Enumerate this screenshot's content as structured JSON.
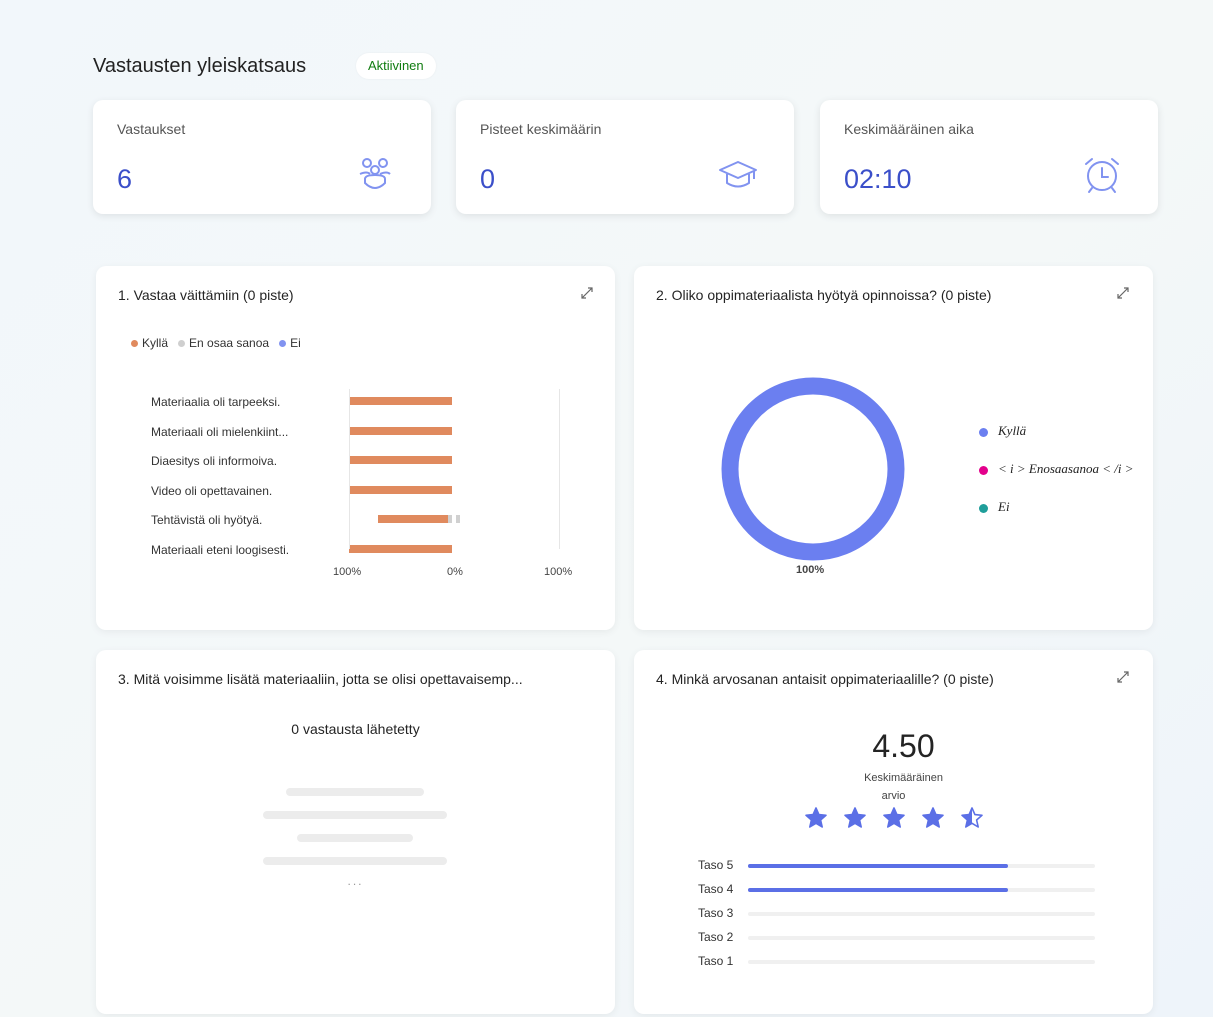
{
  "header": {
    "title": "Vastausten yleiskatsaus",
    "status": "Aktiivinen"
  },
  "colors": {
    "accent": "#3b4fc9",
    "bar": "#e08a5e",
    "donut": "#6b7ff0",
    "star": "#5b6fe6",
    "badge": "#107c10"
  },
  "stats": [
    {
      "label": "Vastaukset",
      "value": "6",
      "icon": "people-icon"
    },
    {
      "label": "Pisteet keskimäärin",
      "value": "0",
      "icon": "graduation-cap-icon"
    },
    {
      "label": "Keskimääräinen aika",
      "value": "02:10",
      "icon": "alarm-clock-icon"
    }
  ],
  "q1": {
    "title": "1. Vastaa väittämiin (0 piste)",
    "legend": [
      "Kyllä",
      "En osaa sanoa",
      "Ei"
    ],
    "axis": [
      "100%",
      "0%",
      "100%"
    ]
  },
  "chart_data": {
    "type": "bar",
    "categories": [
      "Materiaalia oli tarpeeksi.",
      "Materiaali oli mielenkiint...",
      "Diaesitys oli informoiva.",
      "Video oli opettavainen.",
      "Tehtävistä oli hyötyä.",
      "Materiaali eteni loogisesti."
    ],
    "series": [
      {
        "name": "Kyllä",
        "values": [
          100,
          100,
          100,
          100,
          83,
          100
        ]
      },
      {
        "name": "En osaa sanoa",
        "values": [
          0,
          0,
          0,
          0,
          17,
          0
        ]
      },
      {
        "name": "Ei",
        "values": [
          0,
          0,
          0,
          0,
          0,
          0
        ]
      }
    ]
  },
  "q2": {
    "title": "2. Oliko oppimateriaalista hyötyä opinnoissa? (0 piste)",
    "pct": "100%",
    "legend": [
      "Kyllä",
      "< i > Enosaasanoa < /i >",
      "Ei"
    ]
  },
  "q3": {
    "title": "3. Mitä voisimme lisätä materiaaliin, jotta se olisi opettavaisemp...",
    "count": "0 vastausta lähetetty",
    "more": "..."
  },
  "q4": {
    "title": "4. Minkä arvosanan antaisit oppimateriaalille? (0 piste)",
    "avg": "4.50",
    "avg_label_1": "Keskimääräinen",
    "avg_label_2": "arvio",
    "rating": 4.5,
    "levels": [
      {
        "label": "Taso 5",
        "fraction": 0.75
      },
      {
        "label": "Taso 4",
        "fraction": 0.75
      },
      {
        "label": "Taso 3",
        "fraction": 0
      },
      {
        "label": "Taso 2",
        "fraction": 0
      },
      {
        "label": "Taso 1",
        "fraction": 0
      }
    ]
  }
}
